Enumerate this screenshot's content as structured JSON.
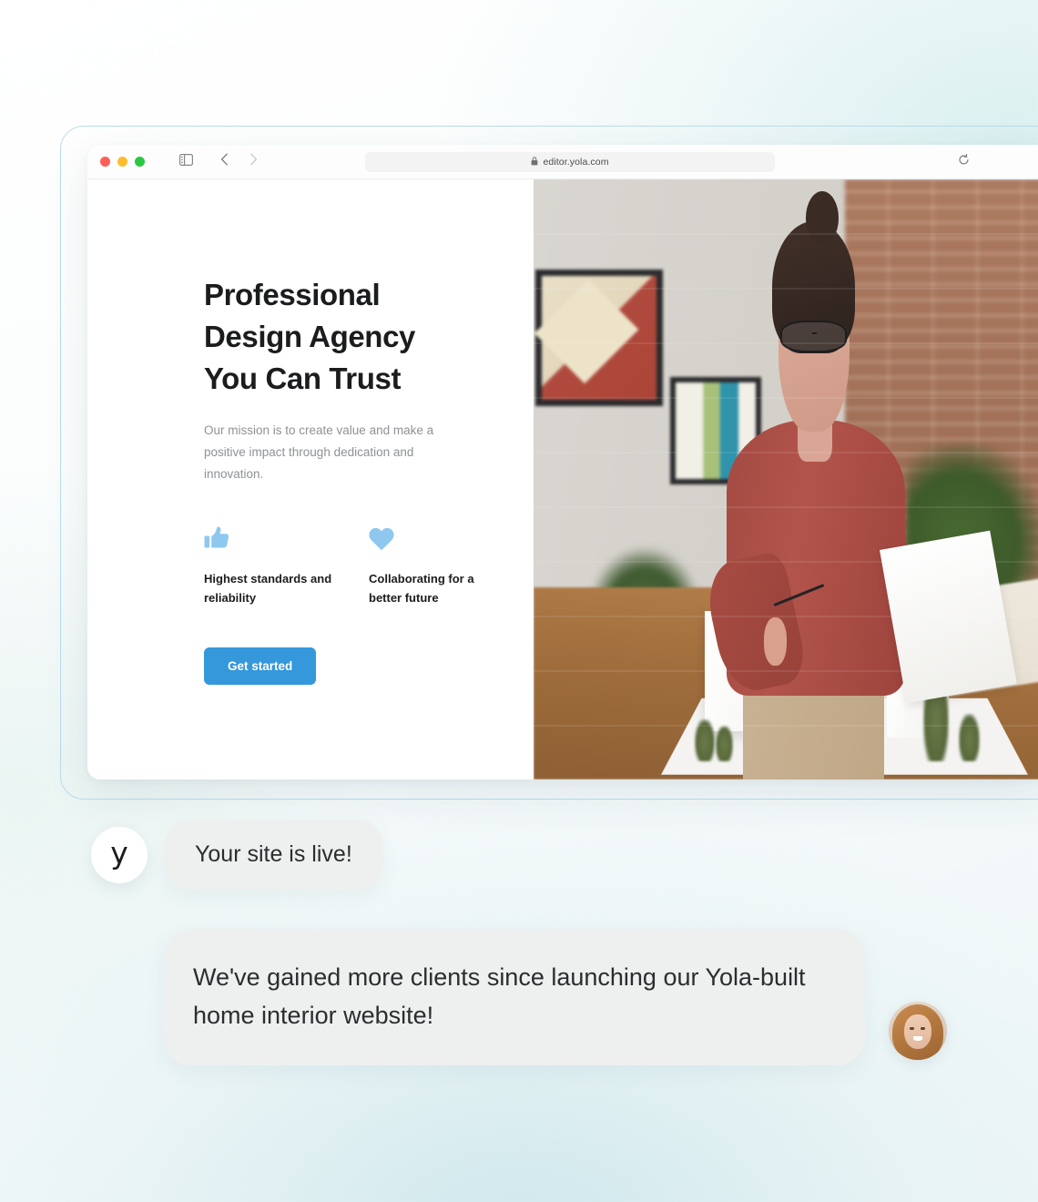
{
  "browser": {
    "traffic_lights": [
      "close",
      "minimize",
      "maximize"
    ],
    "sidebar_toggle_icon": "sidebar-icon",
    "back_icon": "chevron-left-icon",
    "forward_icon": "chevron-right-icon",
    "shield_icon": "privacy-shield-icon",
    "lock_icon": "lock-icon",
    "url": "editor.yola.com",
    "reload_icon": "reload-icon"
  },
  "site": {
    "title": "Professional Design Agency You Can Trust",
    "title_lines": [
      "Professional",
      "Design Agency",
      "You Can Trust"
    ],
    "subtitle": "Our mission is to create value and make a positive impact through dedication and innovation.",
    "features": [
      {
        "icon": "thumbs-up-icon",
        "label": "Highest standards and reliability"
      },
      {
        "icon": "heart-icon",
        "label": "Collaborating for a better future"
      }
    ],
    "cta_label": "Get started",
    "hero_image_alt": "Designer reviewing plans beside an architectural model"
  },
  "chat": {
    "brand_avatar_letter": "y",
    "messages": [
      {
        "from": "yola",
        "text": "Your site is live!"
      },
      {
        "from": "user",
        "text": "We've gained more clients since launching our Yola-built home interior website!"
      }
    ],
    "user_avatar_alt": "Smiling woman with long hair"
  },
  "colors": {
    "accent": "#3498db",
    "feature_icon": "#8ec8ef",
    "bubble_bg": "#eef0f0",
    "heading": "#1b1c1e",
    "muted_text": "#8e9195",
    "frame_border": "#b9dced"
  }
}
